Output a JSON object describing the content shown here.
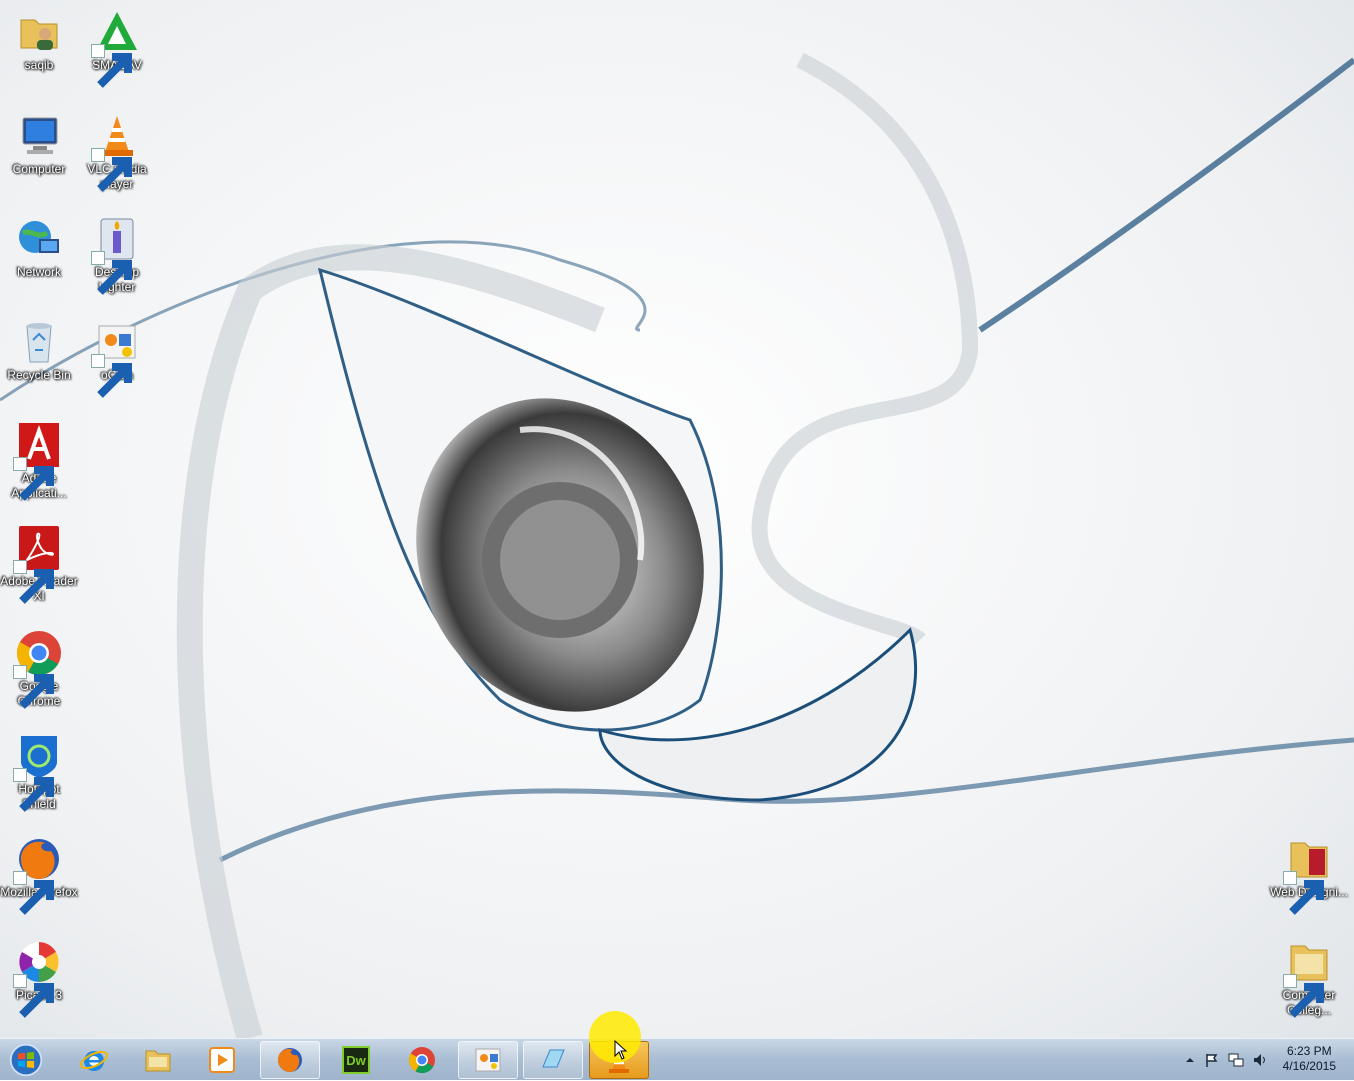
{
  "desktop": {
    "icons_left": [
      {
        "label": "saqib",
        "icon": "user-folder-icon"
      },
      {
        "label": "SMADAV",
        "icon": "smadav-icon"
      },
      {
        "label": "Computer",
        "icon": "computer-icon"
      },
      {
        "label": "VLC media player",
        "icon": "vlc-icon"
      },
      {
        "label": "Network",
        "icon": "network-icon"
      },
      {
        "label": "Desktop Lighter",
        "icon": "desktop-lighter-icon"
      },
      {
        "label": "Recycle Bin",
        "icon": "recycle-bin-icon"
      },
      {
        "label": "oCam",
        "icon": "ocam-icon"
      },
      {
        "label": "Adobe Applicati...",
        "icon": "adobe-icon"
      },
      {
        "label": "Adobe Reader XI",
        "icon": "adobe-reader-icon"
      },
      {
        "label": "Google Chrome",
        "icon": "chrome-icon"
      },
      {
        "label": "Hotspot Shield",
        "icon": "hotspot-shield-icon"
      },
      {
        "label": "Mozilla Firefox",
        "icon": "firefox-icon"
      },
      {
        "label": "Picasa 3",
        "icon": "picasa-icon"
      }
    ],
    "icons_right": [
      {
        "label": "Web Designi...",
        "icon": "folder-icon"
      },
      {
        "label": "Computer Colleg...",
        "icon": "folder-icon"
      }
    ]
  },
  "taskbar": {
    "start": "windows-orb-icon",
    "pinned": [
      {
        "name": "internet-explorer",
        "icon": "ie-icon"
      },
      {
        "name": "windows-explorer",
        "icon": "explorer-folder-icon"
      },
      {
        "name": "media-player",
        "icon": "media-player-icon"
      },
      {
        "name": "firefox",
        "icon": "firefox-icon"
      },
      {
        "name": "dreamweaver",
        "icon": "dreamweaver-icon",
        "text": "Dw"
      },
      {
        "name": "chrome",
        "icon": "chrome-icon"
      },
      {
        "name": "ocam",
        "icon": "ocam-icon"
      },
      {
        "name": "desktop-lighter",
        "icon": "lighter-icon"
      },
      {
        "name": "vlc",
        "icon": "vlc-icon"
      }
    ],
    "tray": {
      "time": "6:23 PM",
      "date": "4/16/2015"
    }
  },
  "colors": {
    "taskbar": "#a9bdd3",
    "active_button": "#f0b040",
    "wallpaper_accent": "#1b4f7a"
  }
}
